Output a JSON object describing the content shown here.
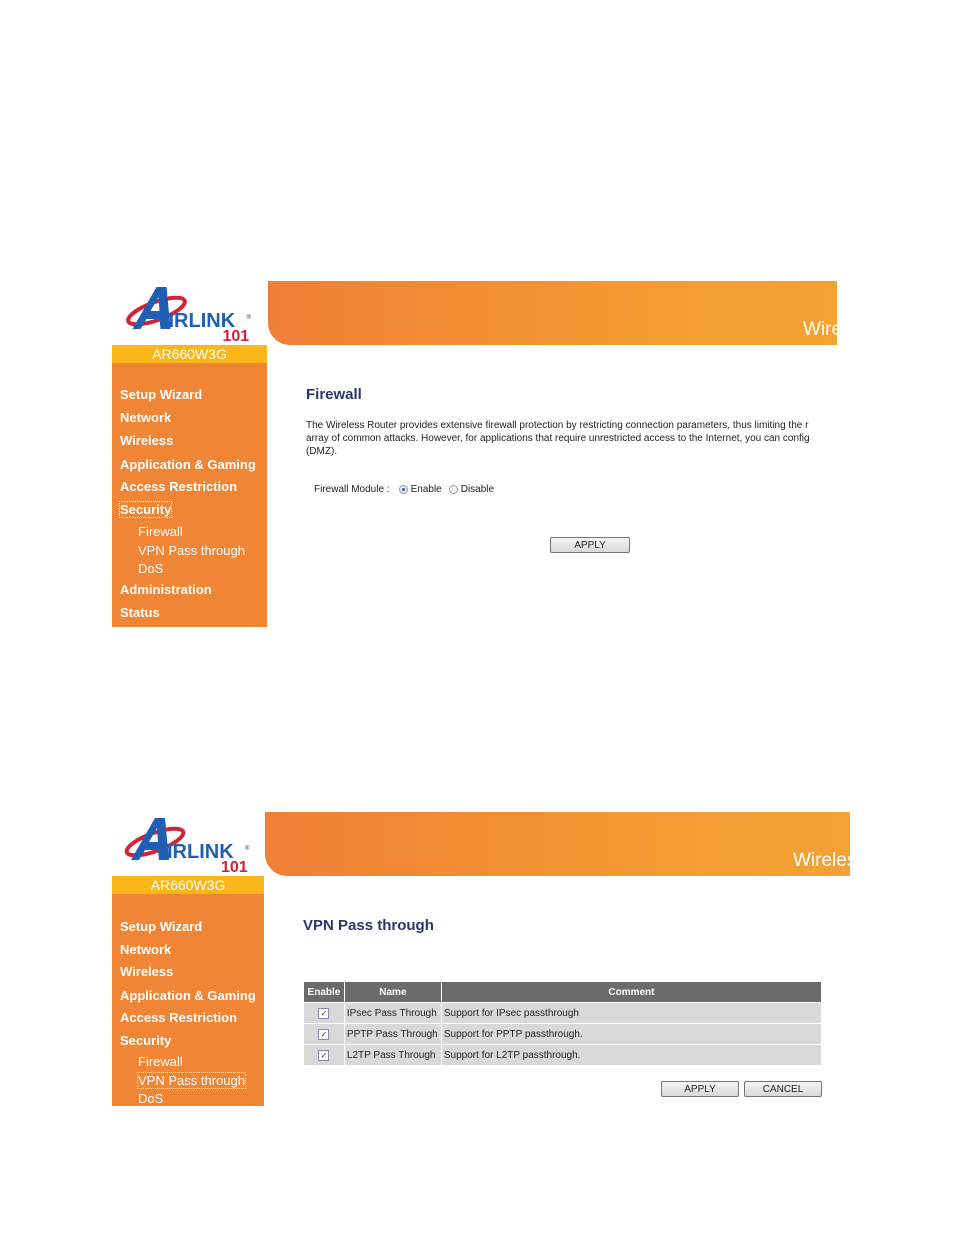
{
  "colors": {
    "sidebar": "#f08536",
    "model_bar": "#fbb71a",
    "title": "#2d3570"
  },
  "logo": {
    "text": "AIRLINK 101"
  },
  "shots": [
    {
      "model": "AR660W3G",
      "banner_text": "Wire",
      "nav": [
        {
          "label": "Setup Wizard"
        },
        {
          "label": "Network"
        },
        {
          "label": "Wireless"
        },
        {
          "label": "Application & Gaming"
        },
        {
          "label": "Access Restriction"
        },
        {
          "label": "Security",
          "selected": true
        },
        {
          "label": "Firewall",
          "sub": true
        },
        {
          "label": "VPN Pass through",
          "sub": true
        },
        {
          "label": "DoS",
          "sub": true
        },
        {
          "label": "Administration"
        },
        {
          "label": "Status"
        }
      ],
      "title": "Firewall",
      "paragraph": [
        "The Wireless Router provides extensive firewall protection by restricting connection parameters, thus limiting the r",
        "array of common attacks. However, for applications that require unrestricted access to the Internet, you can config",
        "(DMZ)."
      ],
      "module_label": "Firewall Module :",
      "options": [
        {
          "label": "Enable",
          "checked": true
        },
        {
          "label": "Disable",
          "checked": false
        }
      ],
      "apply": "APPLY"
    },
    {
      "model": "AR660W3G",
      "banner_text": "Wireles",
      "nav": [
        {
          "label": "Setup Wizard"
        },
        {
          "label": "Network"
        },
        {
          "label": "Wireless"
        },
        {
          "label": "Application & Gaming"
        },
        {
          "label": "Access Restriction"
        },
        {
          "label": "Security"
        },
        {
          "label": "Firewall",
          "sub": true
        },
        {
          "label": "VPN Pass through",
          "sub": true,
          "selected": true
        },
        {
          "label": "DoS",
          "sub": true
        }
      ],
      "title": "VPN Pass through",
      "table": {
        "headers": [
          "Enable",
          "Name",
          "Comment"
        ],
        "rows": [
          {
            "enabled": true,
            "name": "IPsec Pass Through",
            "comment": "Support for IPsec passthrough"
          },
          {
            "enabled": true,
            "name": "PPTP Pass Through",
            "comment": "Support for PPTP passthrough."
          },
          {
            "enabled": true,
            "name": "L2TP Pass Through",
            "comment": "Support for L2TP passthrough."
          }
        ]
      },
      "apply": "APPLY",
      "cancel": "CANCEL"
    }
  ]
}
